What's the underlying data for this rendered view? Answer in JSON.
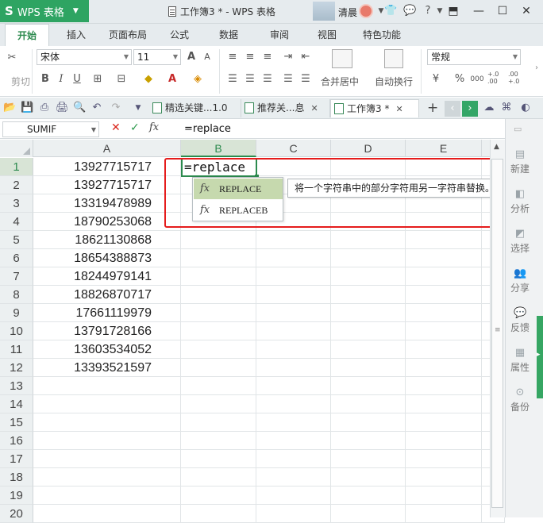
{
  "app": {
    "brand_logo": "S",
    "brand_name": "WPS 表格",
    "doc_title": "工作簿3 * - WPS 表格",
    "user_name": "清晨"
  },
  "menu_tabs": [
    "开始",
    "插入",
    "页面布局",
    "公式",
    "数据",
    "审阅",
    "视图",
    "特色功能"
  ],
  "ribbon": {
    "font_name": "宋体",
    "font_size": "11",
    "number_format": "常规",
    "merge_center_label": "合并居中",
    "wrap_text_label": "自动换行",
    "clipboard_label": "剪切",
    "percent_symbol": "%",
    "thousands_symbol": "000",
    "decimal_increase": "+.0\n.00",
    "decimal_decrease": ".00\n+.0"
  },
  "doc_tabs": [
    {
      "label": "精选关键...1.0"
    },
    {
      "label": "推荐关...息"
    },
    {
      "label": "工作簿3 *"
    }
  ],
  "formula_bar": {
    "name_box": "SUMIF",
    "cancel_symbol": "✕",
    "accept_symbol": "✓",
    "fx_symbol": "fx",
    "formula": "=replace"
  },
  "columns": [
    "A",
    "B",
    "C",
    "D",
    "E"
  ],
  "rows": [
    {
      "num": "1",
      "a": "13927715717"
    },
    {
      "num": "2",
      "a": "13927715717"
    },
    {
      "num": "3",
      "a": "13319478989"
    },
    {
      "num": "4",
      "a": "18790253068"
    },
    {
      "num": "5",
      "a": "18621130868"
    },
    {
      "num": "6",
      "a": "18654388873"
    },
    {
      "num": "7",
      "a": "18244979141"
    },
    {
      "num": "8",
      "a": "18826870717"
    },
    {
      "num": "9",
      "a": "17661119979"
    },
    {
      "num": "10",
      "a": "13791728166"
    },
    {
      "num": "11",
      "a": "13603534052"
    },
    {
      "num": "12",
      "a": "13393521597"
    },
    {
      "num": "13",
      "a": ""
    },
    {
      "num": "14",
      "a": ""
    },
    {
      "num": "15",
      "a": ""
    },
    {
      "num": "16",
      "a": ""
    },
    {
      "num": "17",
      "a": ""
    },
    {
      "num": "18",
      "a": ""
    },
    {
      "num": "19",
      "a": ""
    },
    {
      "num": "20",
      "a": ""
    }
  ],
  "active_cell": {
    "ref": "B1",
    "value": "=replace"
  },
  "autocomplete": {
    "items": [
      {
        "fx": "fx",
        "name": "REPLACE"
      },
      {
        "fx": "fx",
        "name": "REPLACEB"
      }
    ],
    "tooltip": "将一个字符串中的部分字符用另一字符串替换。"
  },
  "side_panel": [
    "新建",
    "分析",
    "选择",
    "分享",
    "反馈",
    "属性",
    "备份"
  ],
  "colors": {
    "brand_green": "#2ea462",
    "highlight": "#e51c1c",
    "selected_item": "#c6d9ae"
  }
}
